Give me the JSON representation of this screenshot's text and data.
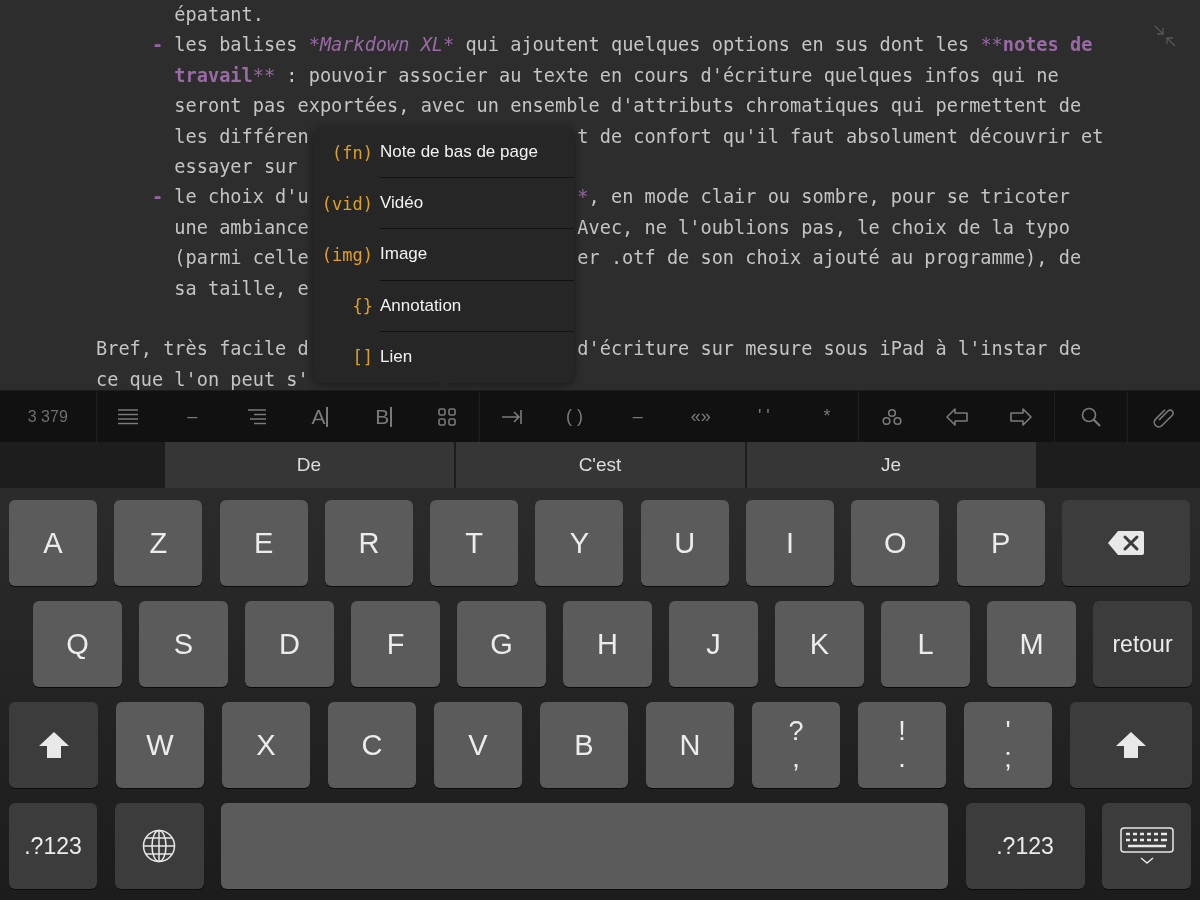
{
  "editor": {
    "lines": [
      {
        "kind": "continuation",
        "left": [
          {
            "kind": "plain",
            "text": "épatant."
          }
        ]
      },
      {
        "kind": "bullet",
        "marker": "-",
        "left": [
          {
            "kind": "plain",
            "text": "les balises "
          },
          {
            "kind": "italic",
            "text": "*Markdown XL*"
          },
          {
            "kind": "plain",
            "text": " qui ajoutent quelques options en sus dont les "
          },
          {
            "kind": "mark",
            "text": "**"
          },
          {
            "kind": "bold",
            "text": "notes de"
          }
        ]
      },
      {
        "kind": "continuation",
        "left": [
          {
            "kind": "bold",
            "text": "travail"
          },
          {
            "kind": "mark",
            "text": "**"
          },
          {
            "kind": "plain",
            "text": " : pouvoir associer au texte en cours d'écriture quelques infos qui ne"
          }
        ]
      },
      {
        "kind": "continuation",
        "left": [
          {
            "kind": "plain",
            "text": "seront pas exportées, avec un ensemble d'attributs chromatiques qui permettent de"
          }
        ]
      },
      {
        "kind": "continuation",
        "left": [
          {
            "kind": "plain",
            "text": "les différen"
          }
        ],
        "right": [
          {
            "kind": "plain",
            "text": "t de confort qu'il faut absolument découvrir et"
          }
        ]
      },
      {
        "kind": "continuation",
        "left": [
          {
            "kind": "plain",
            "text": "essayer sur"
          }
        ]
      },
      {
        "kind": "bullet",
        "marker": "-",
        "left": [
          {
            "kind": "plain",
            "text": "le choix d'u"
          }
        ],
        "right": [
          {
            "kind": "mark",
            "text": "*"
          },
          {
            "kind": "plain",
            "text": ", en mode clair ou sombre, pour se tricoter"
          }
        ]
      },
      {
        "kind": "continuation",
        "left": [
          {
            "kind": "plain",
            "text": "une ambiance"
          }
        ],
        "right": [
          {
            "kind": "plain",
            "text": "Avec, ne l'oublions pas, le choix de la typo"
          }
        ]
      },
      {
        "kind": "continuation",
        "left": [
          {
            "kind": "plain",
            "text": "(parmi celle"
          }
        ],
        "right": [
          {
            "kind": "plain",
            "text": "er .otf de son choix ajouté au programme), de"
          }
        ]
      },
      {
        "kind": "continuation",
        "left": [
          {
            "kind": "plain",
            "text": "sa taille, e"
          }
        ]
      },
      {
        "kind": "blank"
      },
      {
        "kind": "paragraph",
        "left": [
          {
            "kind": "plain",
            "text": "Bref, très facile d"
          }
        ],
        "right": [
          {
            "kind": "plain",
            "text": "d'écriture sur mesure sous iPad à l'instar de"
          }
        ]
      },
      {
        "kind": "paragraph",
        "left": [
          {
            "kind": "plain",
            "text": "ce que l'on peut s'"
          }
        ]
      }
    ]
  },
  "menu": {
    "items": [
      {
        "code": "(fn)",
        "label": "Note de bas de page"
      },
      {
        "code": "(vid)",
        "label": "Vidéo"
      },
      {
        "code": "(img)",
        "label": "Image"
      },
      {
        "code": "{}",
        "label": "Annotation"
      },
      {
        "code": "[]",
        "label": "Lien"
      }
    ]
  },
  "toolbar": {
    "counter": "3 379",
    "groups": [
      {
        "items": [
          {
            "kind": "lines"
          },
          {
            "kind": "text",
            "label": "–"
          },
          {
            "kind": "align-right"
          },
          {
            "kind": "letter",
            "label": "A"
          },
          {
            "kind": "letter",
            "label": "B"
          },
          {
            "kind": "grid"
          }
        ]
      },
      {
        "items": [
          {
            "kind": "tab"
          },
          {
            "kind": "text",
            "label": "( )"
          },
          {
            "kind": "text",
            "label": "–"
          },
          {
            "kind": "text",
            "label": "«»"
          },
          {
            "kind": "text",
            "label": "' '"
          },
          {
            "kind": "text",
            "label": "*"
          }
        ]
      },
      {
        "items": [
          {
            "kind": "circles"
          },
          {
            "kind": "arrow-left"
          },
          {
            "kind": "arrow-right"
          }
        ]
      },
      {
        "items": [
          {
            "kind": "search"
          }
        ]
      },
      {
        "items": [
          {
            "kind": "clip"
          }
        ]
      }
    ]
  },
  "suggestions": [
    "De",
    "C'est",
    "Je"
  ],
  "keyboard": {
    "rows": [
      {
        "keys": [
          {
            "kind": "letter",
            "label": "A"
          },
          {
            "kind": "letter",
            "label": "Z"
          },
          {
            "kind": "letter",
            "label": "E"
          },
          {
            "kind": "letter",
            "label": "R"
          },
          {
            "kind": "letter",
            "label": "T"
          },
          {
            "kind": "letter",
            "label": "Y"
          },
          {
            "kind": "letter",
            "label": "U"
          },
          {
            "kind": "letter",
            "label": "I"
          },
          {
            "kind": "letter",
            "label": "O"
          },
          {
            "kind": "letter",
            "label": "P"
          },
          {
            "kind": "backspace"
          }
        ]
      },
      {
        "keys": [
          {
            "kind": "letter",
            "label": "Q"
          },
          {
            "kind": "letter",
            "label": "S"
          },
          {
            "kind": "letter",
            "label": "D"
          },
          {
            "kind": "letter",
            "label": "F"
          },
          {
            "kind": "letter",
            "label": "G"
          },
          {
            "kind": "letter",
            "label": "H"
          },
          {
            "kind": "letter",
            "label": "J"
          },
          {
            "kind": "letter",
            "label": "K"
          },
          {
            "kind": "letter",
            "label": "L"
          },
          {
            "kind": "letter",
            "label": "M"
          },
          {
            "kind": "return",
            "label": "retour"
          }
        ]
      },
      {
        "keys": [
          {
            "kind": "shift"
          },
          {
            "kind": "letter",
            "label": "W"
          },
          {
            "kind": "letter",
            "label": "X"
          },
          {
            "kind": "letter",
            "label": "C"
          },
          {
            "kind": "letter",
            "label": "V"
          },
          {
            "kind": "letter",
            "label": "B"
          },
          {
            "kind": "letter",
            "label": "N"
          },
          {
            "kind": "punct",
            "top": "?",
            "bottom": ","
          },
          {
            "kind": "punct",
            "top": "!",
            "bottom": "."
          },
          {
            "kind": "punct",
            "top": "'",
            "bottom": ";"
          },
          {
            "kind": "shift"
          }
        ]
      },
      {
        "keys": [
          {
            "kind": "mode",
            "label": ".?123"
          },
          {
            "kind": "globe"
          },
          {
            "kind": "space"
          },
          {
            "kind": "mode",
            "label": ".?123"
          },
          {
            "kind": "hide"
          }
        ]
      }
    ]
  }
}
